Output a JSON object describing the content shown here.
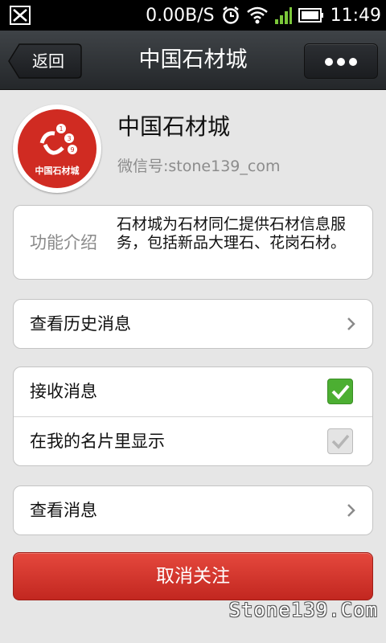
{
  "status_bar": {
    "speed": "0.00B/S",
    "time": "11:49"
  },
  "header": {
    "back_label": "返回",
    "title": "中国石材城"
  },
  "profile": {
    "name": "中国石材城",
    "wechat_id": "微信号:stone139_com",
    "avatar_text": "中国石材城"
  },
  "intro": {
    "label": "功能介绍",
    "text": "石材城为石材同仁提供石材信息服务，包括新品大理石、花岗石材。"
  },
  "history": {
    "label": "查看历史消息"
  },
  "settings": {
    "receive_label": "接收消息",
    "receive_checked": true,
    "show_card_label": "在我的名片里显示",
    "show_card_checked": true
  },
  "view_messages": {
    "label": "查看消息"
  },
  "unfollow": {
    "label": "取消关注"
  },
  "watermark": "Stone139.Com",
  "colors": {
    "accent_red": "#d02b22",
    "check_green": "#4caf32",
    "titlebar": "#2c2f33"
  }
}
